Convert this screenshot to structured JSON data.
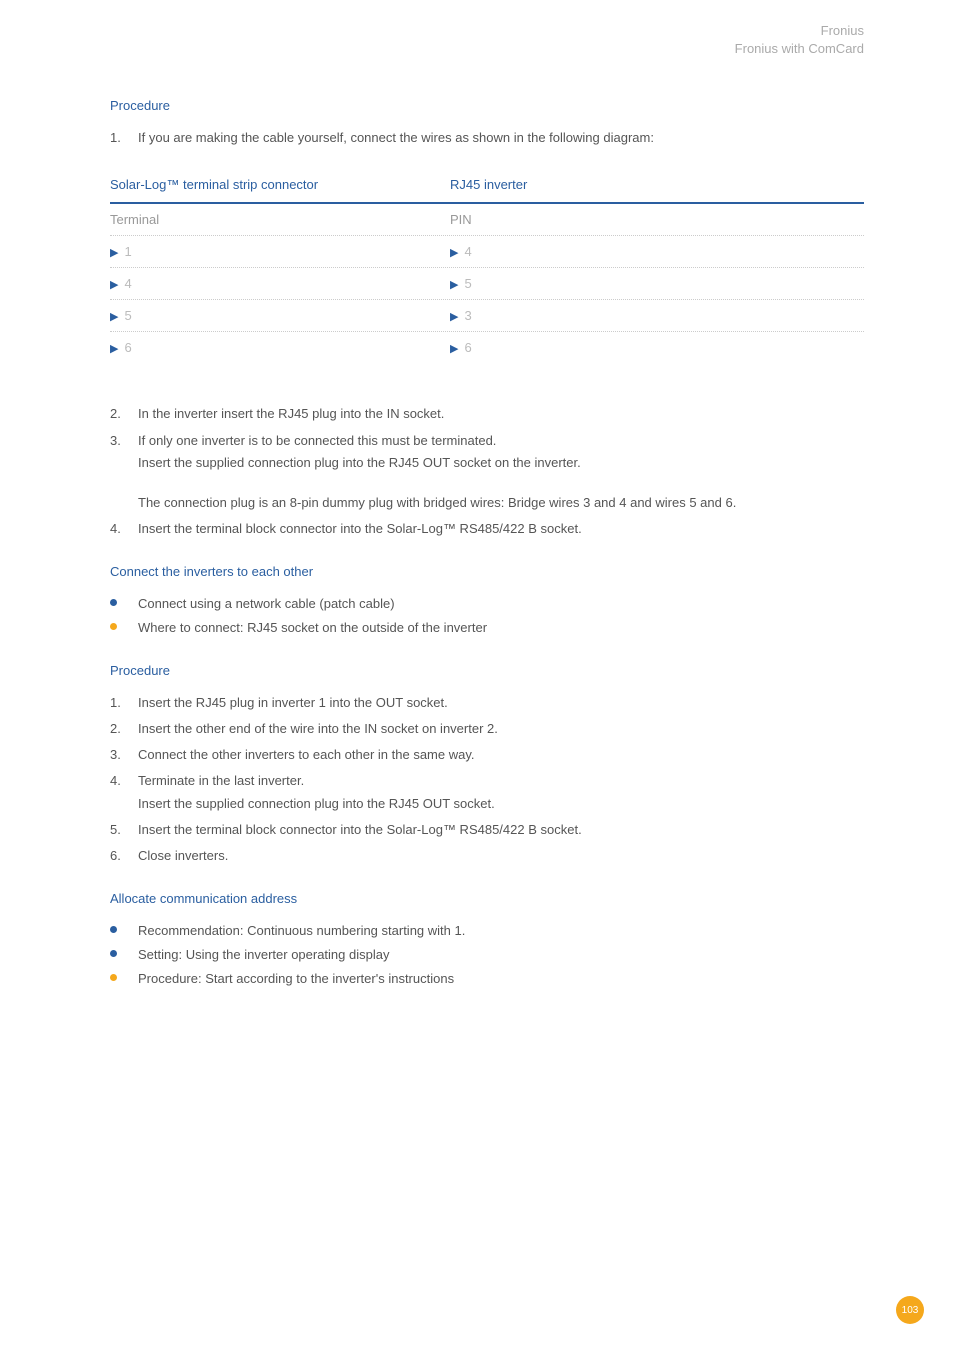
{
  "header": {
    "line1": "Fronius",
    "line2": "Fronius with ComCard"
  },
  "s1": {
    "title": "Procedure",
    "item1_num": "1.",
    "item1_text": "If you are making the cable yourself, connect the wires as shown in the following diagram:"
  },
  "table": {
    "head_left": "Solar-Log™ terminal strip connector",
    "head_right": "RJ45 inverter",
    "sub_left": "Terminal",
    "sub_right": "PIN",
    "rows": [
      {
        "l": "1",
        "r": "4"
      },
      {
        "l": "4",
        "r": "5"
      },
      {
        "l": "5",
        "r": "3"
      },
      {
        "l": "6",
        "r": "6"
      }
    ]
  },
  "s1b": {
    "item2_num": "2.",
    "item2_text": "In the inverter insert the RJ45 plug into the IN socket.",
    "item3_num": "3.",
    "item3_line1": "If only one inverter is to be connected this must be terminated.",
    "item3_line2": "Insert the supplied connection plug into the RJ45 OUT socket on the inverter.",
    "item3_line3": "The connection plug is an 8-pin dummy plug with bridged wires: Bridge wires 3 and 4 and wires 5 and 6.",
    "item4_num": "4.",
    "item4_text": "Insert the terminal block connector into the Solar-Log™ RS485/422 B socket."
  },
  "s2": {
    "title": "Connect the inverters to each other",
    "b1": "Connect using a network cable (patch cable)",
    "b2": "Where to connect: RJ45 socket on the outside of the inverter"
  },
  "s3": {
    "title": "Procedure",
    "i1n": "1.",
    "i1": "Insert the RJ45 plug in inverter 1 into the OUT socket.",
    "i2n": "2.",
    "i2": "Insert the other end of the wire into the IN socket on inverter 2.",
    "i3n": "3.",
    "i3": "Connect the other inverters to each other in the same way.",
    "i4n": "4.",
    "i4a": "Terminate in the last inverter.",
    "i4b": "Insert the supplied connection plug into the RJ45 OUT socket.",
    "i5n": "5.",
    "i5": "Insert the terminal block connector into the Solar-Log™ RS485/422 B socket.",
    "i6n": "6.",
    "i6": "Close inverters."
  },
  "s4": {
    "title": "Allocate communication address",
    "b1": "Recommendation: Continuous numbering starting with 1.",
    "b2": "Setting: Using the inverter operating display",
    "b3": "Procedure: Start according to the inverter's instructions"
  },
  "page_number": "103"
}
